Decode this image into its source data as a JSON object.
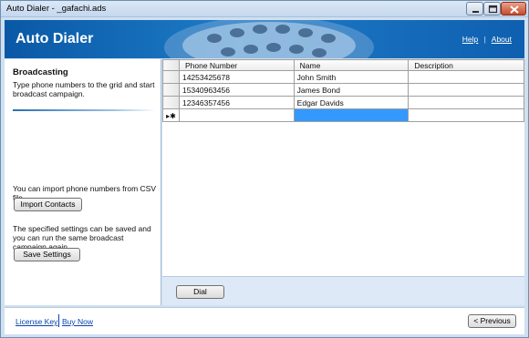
{
  "window": {
    "title": "Auto Dialer - _gafachi.ads",
    "buttons": {
      "minimize_icon": "minimize-icon",
      "maximize_icon": "maximize-icon",
      "close_icon": "close-icon"
    }
  },
  "header": {
    "app_title": "Auto Dialer",
    "help_link": "Help",
    "separator": "|",
    "about_link": "About",
    "graphic": "phone-keypad-graphic",
    "colors": {
      "banner": "#1d7cc7",
      "banner_dark": "#0a58a6"
    }
  },
  "sidebar": {
    "section_title": "Broadcasting",
    "section_desc": "Type phone numbers to the grid and start broadcast campaign.",
    "import_note": "You can import phone numbers from CSV file.",
    "import_button": "Import Contacts",
    "save_note": "The specified settings can be saved and you can run the same broadcast campaign again.",
    "save_button": "Save Settings"
  },
  "grid": {
    "columns": [
      "Phone Number",
      "Name",
      "Description"
    ],
    "rows": [
      {
        "phone": "14253425678",
        "name": "John Smith",
        "description": ""
      },
      {
        "phone": "15340963456",
        "name": "James Bond",
        "description": ""
      },
      {
        "phone": "12346357456",
        "name": "Edgar Davids",
        "description": ""
      }
    ],
    "new_row_marker": "▸✱",
    "selection_color": "#3399ff"
  },
  "actions": {
    "dial_button": "Dial"
  },
  "footer": {
    "license_link": "License Key",
    "buy_link": "Buy Now",
    "previous_button": "< Previous",
    "link_color": "#0645ad"
  }
}
